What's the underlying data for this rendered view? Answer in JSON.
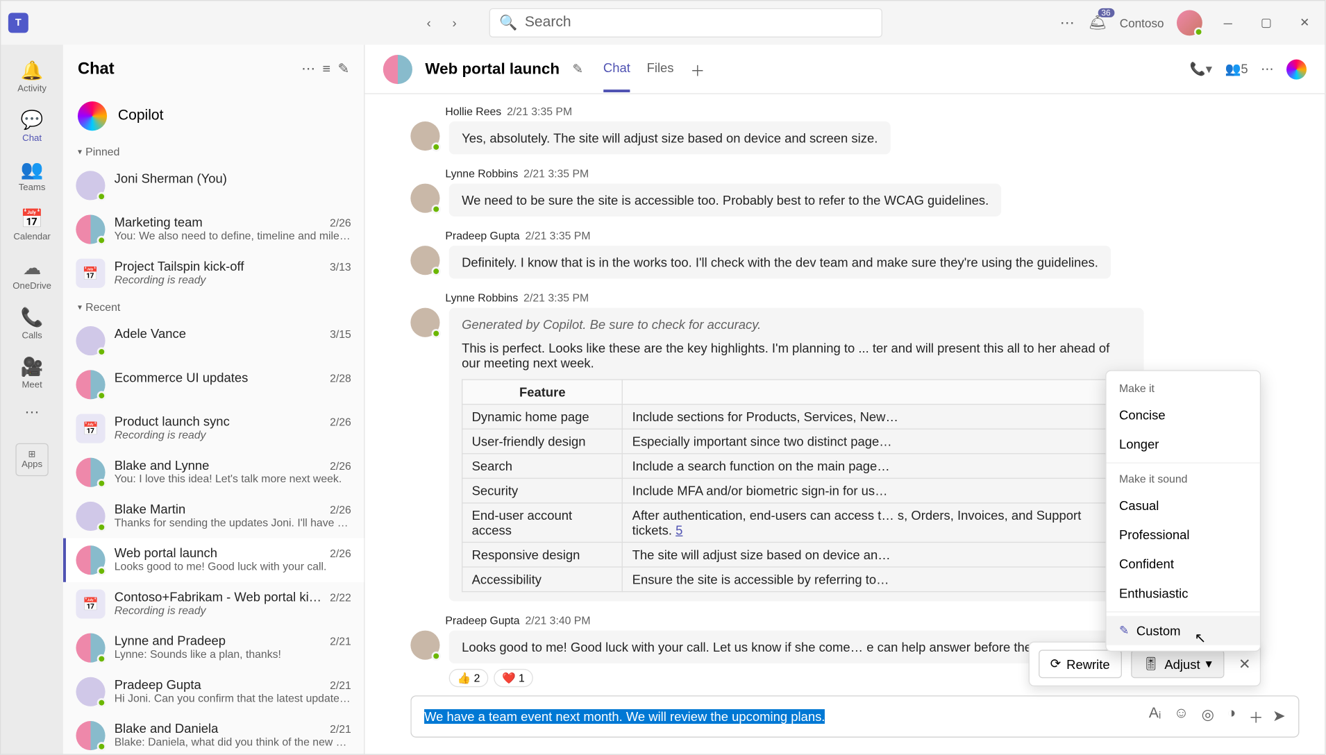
{
  "titlebar": {
    "search_placeholder": "Search",
    "notif_count": "36",
    "org_name": "Contoso"
  },
  "rail": [
    {
      "icon": "🔔",
      "label": "Activity"
    },
    {
      "icon": "💬",
      "label": "Chat",
      "active": true
    },
    {
      "icon": "👥",
      "label": "Teams"
    },
    {
      "icon": "📅",
      "label": "Calendar"
    },
    {
      "icon": "☁",
      "label": "OneDrive"
    },
    {
      "icon": "📞",
      "label": "Calls"
    },
    {
      "icon": "🎥",
      "label": "Meet"
    }
  ],
  "rail_apps_label": "Apps",
  "chatlist": {
    "title": "Chat",
    "copilot": "Copilot",
    "sections": {
      "pinned": "Pinned",
      "recent": "Recent"
    },
    "pinned": [
      {
        "name": "Joni Sherman (You)",
        "date": "",
        "preview": "",
        "av": "solo"
      },
      {
        "name": "Marketing team",
        "date": "2/26",
        "preview": "You: We also need to define, timeline and miles…",
        "av": "grp"
      },
      {
        "name": "Project Tailspin kick-off",
        "date": "3/13",
        "preview": "Recording is ready",
        "italic": true,
        "av": "cal"
      }
    ],
    "recent": [
      {
        "name": "Adele Vance",
        "date": "3/15",
        "preview": "",
        "av": "solo"
      },
      {
        "name": "Ecommerce UI updates",
        "date": "2/28",
        "preview": "",
        "av": "grp"
      },
      {
        "name": "Product launch sync",
        "date": "2/26",
        "preview": "Recording is ready",
        "italic": true,
        "av": "cal"
      },
      {
        "name": "Blake and Lynne",
        "date": "2/26",
        "preview": "You: I love this idea! Let's talk more next week.",
        "av": "grp"
      },
      {
        "name": "Blake Martin",
        "date": "2/26",
        "preview": "Thanks for sending the updates Joni. I'll have s…",
        "av": "solo"
      },
      {
        "name": "Web portal launch",
        "date": "2/26",
        "preview": "Looks good to me! Good luck with your call.",
        "av": "grp",
        "active": true
      },
      {
        "name": "Contoso+Fabrikam - Web portal ki…",
        "date": "2/22",
        "preview": "Recording is ready",
        "italic": true,
        "av": "cal"
      },
      {
        "name": "Lynne and Pradeep",
        "date": "2/21",
        "preview": "Lynne: Sounds like a plan, thanks!",
        "av": "grp"
      },
      {
        "name": "Pradeep Gupta",
        "date": "2/21",
        "preview": "Hi Joni. Can you confirm that the latest updates…",
        "av": "solo"
      },
      {
        "name": "Blake and Daniela",
        "date": "2/21",
        "preview": "Blake: Daniela, what did you think of the new d…",
        "av": "grp"
      }
    ]
  },
  "chat": {
    "title": "Web portal launch",
    "tabs": [
      "Chat",
      "Files"
    ],
    "participants_count": "5",
    "messages": [
      {
        "author": "Hollie Rees",
        "ts": "2/21 3:35 PM",
        "text": "Yes, absolutely. The site will adjust size based on device and screen size."
      },
      {
        "author": "Lynne Robbins",
        "ts": "2/21 3:35 PM",
        "text": "We need to be sure the site is accessible too. Probably best to refer to the WCAG guidelines."
      },
      {
        "author": "Pradeep Gupta",
        "ts": "2/21 3:35 PM",
        "text": "Definitely. I know that is in the works too. I'll check with the dev team and make sure they're using the guidelines."
      }
    ],
    "copilot_msg": {
      "author": "Lynne Robbins",
      "ts": "2/21 3:35 PM",
      "note": "Generated by Copilot. Be sure to check for accuracy.",
      "intro": "This is perfect. Looks like these are the key highlights. I'm planning to ... ter and will present this all to her ahead of our meeting next week.",
      "table_header": "Feature",
      "rows": [
        {
          "f": "Dynamic home page",
          "d": "Include sections for Products, Services, New…"
        },
        {
          "f": "User-friendly design",
          "d": "Especially important since two distinct page…"
        },
        {
          "f": "Search",
          "d": "Include a search function on the main page…"
        },
        {
          "f": "Security",
          "d": "Include MFA and/or biometric sign-in for us…"
        },
        {
          "f": "End-user account access",
          "d": "After authentication, end-users can access t… s, Orders, Invoices, and Support tickets.",
          "link": "5"
        },
        {
          "f": "Responsive design",
          "d": "The site will adjust size based on device an…"
        },
        {
          "f": "Accessibility",
          "d": "Ensure the site is accessible by referring to…"
        }
      ]
    },
    "last_msg": {
      "author": "Pradeep Gupta",
      "ts": "2/21 3:40 PM",
      "text": "Looks good to me! Good luck with your call. Let us know if she come… e can help answer before the on-site meeting.",
      "reacts": [
        {
          "e": "👍",
          "c": "2"
        },
        {
          "e": "❤️",
          "c": "1"
        }
      ]
    }
  },
  "compose": {
    "draft": "We have a team event next month. We will review the upcoming plans."
  },
  "rewrite": {
    "rewrite_label": "Rewrite",
    "adjust_label": "Adjust"
  },
  "adjust_menu": {
    "h1": "Make it",
    "g1": [
      "Concise",
      "Longer"
    ],
    "h2": "Make it sound",
    "g2": [
      "Casual",
      "Professional",
      "Confident",
      "Enthusiastic"
    ],
    "custom": "Custom"
  }
}
